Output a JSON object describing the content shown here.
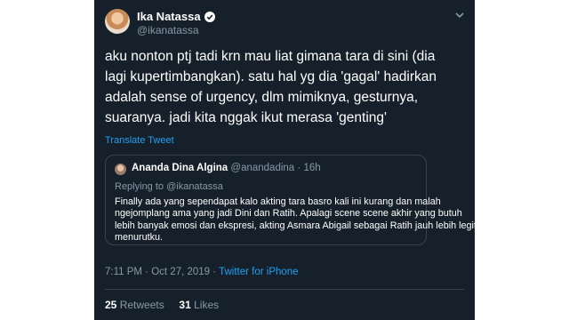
{
  "tweet": {
    "display_name": "Ika Natassa",
    "handle": "@ikanatassa",
    "verified_icon": "verified-badge-icon",
    "menu_icon": "chevron-down-icon",
    "text_lines": [
      "aku nonton ptj tadi krn mau liat gimana tara di sini (dia",
      "lagi kupertimbangkan). satu hal yg dia 'gagal' hadirkan",
      "adalah sense of urgency, dlm mimiknya, gesturnya,",
      "suaranya. jadi kita nggak ikut merasa 'genting'"
    ],
    "translate_label": "Translate Tweet",
    "quoted": {
      "display_name": "Ananda Dina Algina",
      "handle": "@anandadina",
      "time": "16h",
      "replying_to": "Replying to @ikanatassa",
      "text_lines": [
        "Finally ada yang sependapat kalo akting tara basro kali ini kurang dan malah",
        "ngejomplang ama yang jadi Dini dan Ratih. Apalagi scene scene akhir yang butuh",
        "lebih banyak emosi dan ekspresi, akting Asmara Abigail sebagai Ratih jauh lebih legit",
        "menurutku."
      ]
    },
    "time": "7:11 PM",
    "date": "Oct 27, 2019",
    "source": "Twitter for iPhone",
    "retweets_count": "25",
    "retweets_label": "Retweets",
    "likes_count": "31",
    "likes_label": "Likes"
  },
  "colors": {
    "background": "#15202b",
    "accent": "#1da1f2",
    "muted_text": "#8899a6",
    "border": "#38444d"
  }
}
